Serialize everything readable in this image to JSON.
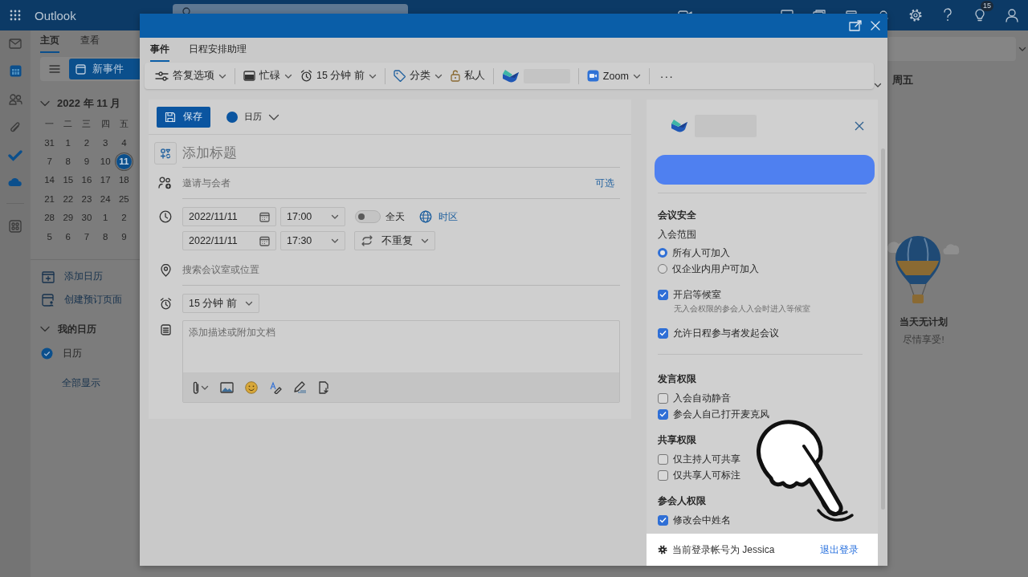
{
  "app": {
    "title": "Outlook",
    "tips_badge": "15"
  },
  "ribbon_tabs": [
    {
      "label": "主页",
      "selected": true
    },
    {
      "label": "查看",
      "selected": false
    }
  ],
  "new_event": {
    "label": "新事件"
  },
  "mini_calendar": {
    "title": "2022 年 11 月",
    "expanded": true,
    "weekdays": [
      "一",
      "二",
      "三",
      "四",
      "五"
    ],
    "weeks": [
      [
        {
          "day": "31",
          "selected": false
        },
        {
          "day": "1",
          "selected": false
        },
        {
          "day": "2",
          "selected": false
        },
        {
          "day": "3",
          "selected": false
        },
        {
          "day": "4",
          "selected": false
        }
      ],
      [
        {
          "day": "7",
          "selected": false
        },
        {
          "day": "8",
          "selected": false
        },
        {
          "day": "9",
          "selected": false
        },
        {
          "day": "10",
          "selected": false
        },
        {
          "day": "11",
          "selected": true
        }
      ],
      [
        {
          "day": "14",
          "selected": false
        },
        {
          "day": "15",
          "selected": false
        },
        {
          "day": "16",
          "selected": false
        },
        {
          "day": "17",
          "selected": false
        },
        {
          "day": "18",
          "selected": false
        }
      ],
      [
        {
          "day": "21",
          "selected": false
        },
        {
          "day": "22",
          "selected": false
        },
        {
          "day": "23",
          "selected": false
        },
        {
          "day": "24",
          "selected": false
        },
        {
          "day": "25",
          "selected": false
        }
      ],
      [
        {
          "day": "28",
          "selected": false
        },
        {
          "day": "29",
          "selected": false
        },
        {
          "day": "30",
          "selected": false
        },
        {
          "day": "1",
          "selected": false
        },
        {
          "day": "2",
          "selected": false
        }
      ],
      [
        {
          "day": "5",
          "selected": false
        },
        {
          "day": "6",
          "selected": false
        },
        {
          "day": "7",
          "selected": false
        },
        {
          "day": "8",
          "selected": false
        },
        {
          "day": "9",
          "selected": false
        }
      ]
    ]
  },
  "nav_links": [
    {
      "label": "添加日历"
    },
    {
      "label": "创建预订页面"
    }
  ],
  "my_calendars": {
    "title": "我的日历",
    "expanded": true,
    "items": [
      {
        "label": "日历",
        "checked": true
      }
    ],
    "show_all": "全部显示"
  },
  "day_view": {
    "weekday": "周五",
    "empty_title": "当天无计划",
    "empty_subtitle": "尽情享受!"
  },
  "dialog": {
    "tabs": [
      {
        "label": "事件",
        "selected": true
      },
      {
        "label": "日程安排助理",
        "selected": false
      }
    ],
    "toolbar": [
      {
        "kind": "dropdown",
        "label": "答复选项"
      },
      {
        "kind": "separator"
      },
      {
        "kind": "dropdown",
        "label": "忙碌"
      },
      {
        "kind": "dropdown",
        "label": "15 分钟 前"
      },
      {
        "kind": "separator"
      },
      {
        "kind": "dropdown",
        "label": "分类"
      },
      {
        "kind": "button",
        "label": "私人"
      },
      {
        "kind": "separator"
      },
      {
        "kind": "addin"
      },
      {
        "kind": "separator"
      },
      {
        "kind": "dropdown",
        "label": "Zoom"
      },
      {
        "kind": "separator"
      },
      {
        "kind": "more",
        "label": "···"
      }
    ],
    "form": {
      "save": "保存",
      "calendar": "日历",
      "title_placeholder": "添加标题",
      "attendees_placeholder": "邀请与会者",
      "optional": "可选",
      "start": {
        "date": "2022/11/11",
        "time": "17:00"
      },
      "end": {
        "date": "2022/11/11",
        "time": "17:30"
      },
      "all_day": {
        "label": "全天",
        "on": false
      },
      "timezone": "时区",
      "repeat": "不重复",
      "location_placeholder": "搜索会议室或位置",
      "reminder": "15 分钟 前",
      "description_placeholder": "添加描述或附加文档"
    },
    "meeting_panel": {
      "items": [
        {
          "kind": "heading",
          "text": "会议安全"
        },
        {
          "kind": "label",
          "text": "入会范围"
        },
        {
          "kind": "radio",
          "label": "所有人可加入",
          "selected": true
        },
        {
          "kind": "radio",
          "label": "仅企业内用户可加入",
          "selected": false
        },
        {
          "kind": "checkbox",
          "label": "开启等候室",
          "checked": true,
          "hint": "无入会权限的参会人入会时进入等候室"
        },
        {
          "kind": "checkbox",
          "label": "允许日程参与者发起会议",
          "checked": true
        },
        {
          "kind": "divider"
        },
        {
          "kind": "heading",
          "text": "发言权限"
        },
        {
          "kind": "checkbox",
          "label": "入会自动静音",
          "checked": false
        },
        {
          "kind": "checkbox",
          "label": "参会人自己打开麦克风",
          "checked": true
        },
        {
          "kind": "heading",
          "text": "共享权限"
        },
        {
          "kind": "checkbox",
          "label": "仅主持人可共享",
          "checked": false
        },
        {
          "kind": "checkbox",
          "label": "仅共享人可标注",
          "checked": false
        },
        {
          "kind": "heading",
          "text": "参会人权限"
        },
        {
          "kind": "checkbox",
          "label": "修改会中姓名",
          "checked": true
        }
      ],
      "footer": {
        "account": "当前登录帐号为 Jessica",
        "logout": "退出登录"
      }
    }
  }
}
